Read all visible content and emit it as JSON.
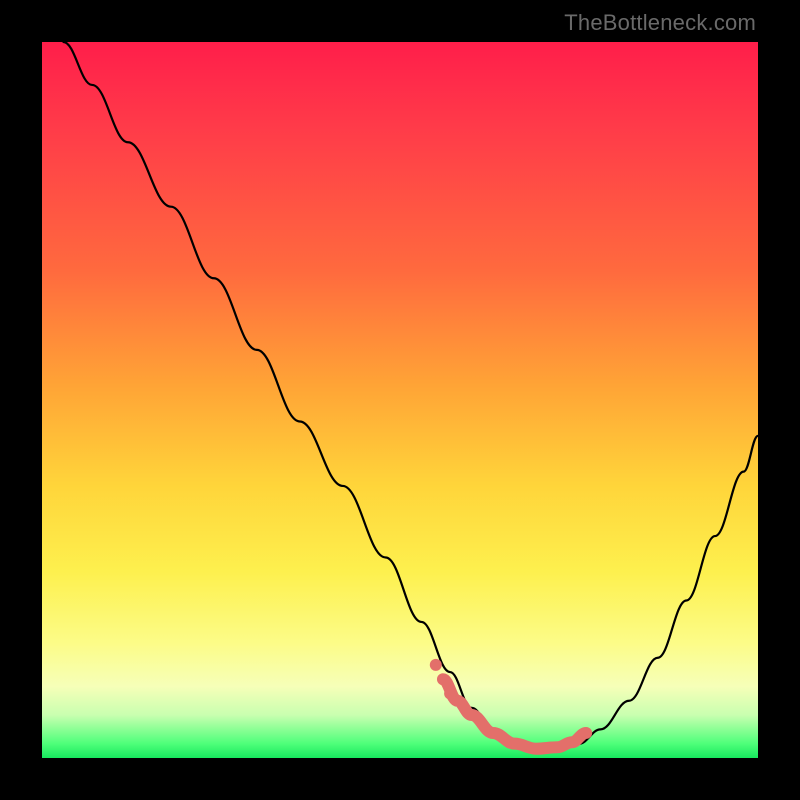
{
  "watermark": "TheBottleneck.com",
  "colors": {
    "background": "#000000",
    "gradient_top": "#ff1e4a",
    "gradient_mid": "#ffd53a",
    "gradient_bottom": "#17e85e",
    "curve": "#000000",
    "highlight": "#e36f6a"
  },
  "chart_data": {
    "type": "line",
    "title": "",
    "xlabel": "",
    "ylabel": "",
    "xlim": [
      0,
      100
    ],
    "ylim": [
      0,
      100
    ],
    "grid": false,
    "legend": false,
    "series": [
      {
        "name": "bottleneck-curve",
        "x": [
          3,
          7,
          12,
          18,
          24,
          30,
          36,
          42,
          48,
          53,
          57,
          60,
          63,
          66,
          69,
          72,
          75,
          78,
          82,
          86,
          90,
          94,
          98,
          100
        ],
        "y": [
          100,
          94,
          86,
          77,
          67,
          57,
          47,
          38,
          28,
          19,
          12,
          7,
          4,
          2,
          1,
          1,
          2,
          4,
          8,
          14,
          22,
          31,
          40,
          45
        ]
      }
    ],
    "highlight": {
      "name": "optimum-region",
      "x": [
        56,
        58,
        60,
        63,
        66,
        69,
        72,
        74,
        76
      ],
      "y": [
        11,
        8,
        6,
        3.5,
        2,
        1.3,
        1.5,
        2.2,
        3.5
      ]
    },
    "highlight_markers": [
      {
        "x": 55,
        "y": 13
      },
      {
        "x": 57,
        "y": 9
      }
    ]
  }
}
